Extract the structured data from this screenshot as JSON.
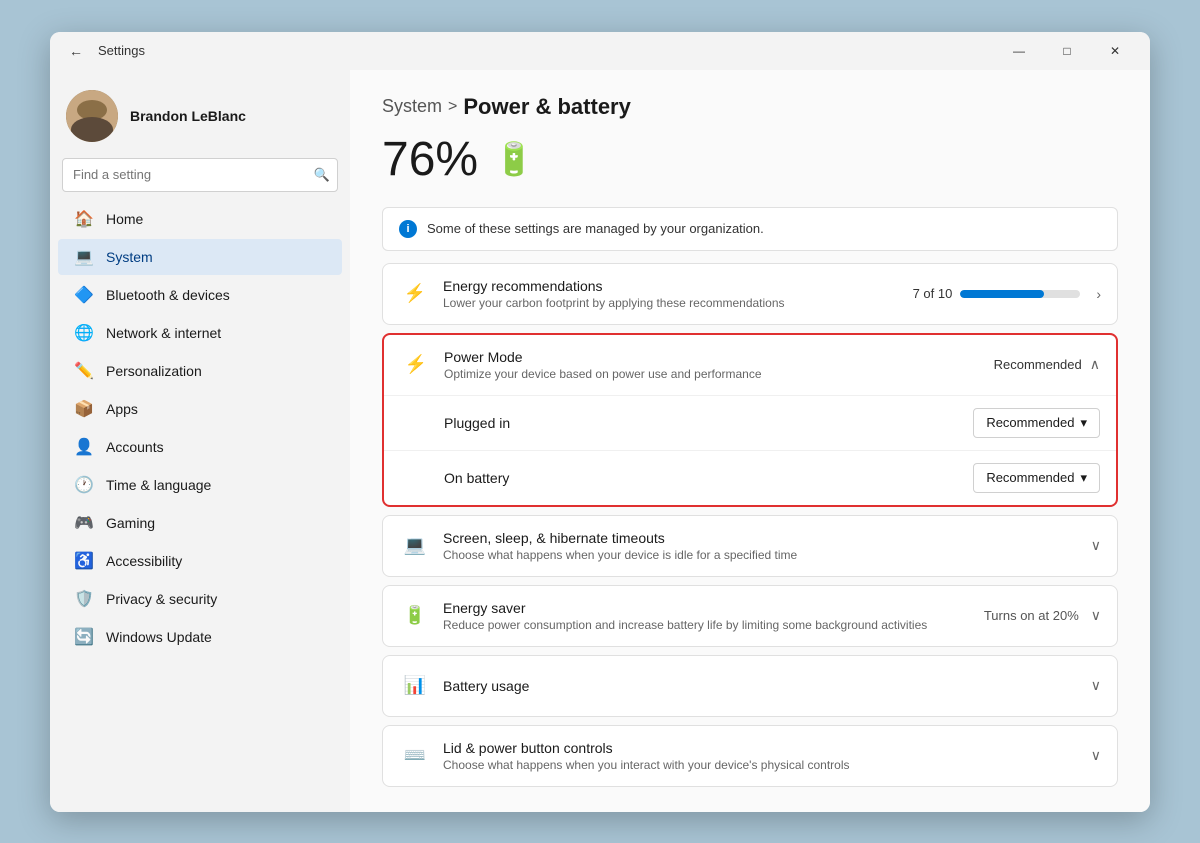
{
  "window": {
    "title": "Settings",
    "back_label": "←",
    "minimize_label": "—",
    "maximize_label": "□",
    "close_label": "✕"
  },
  "user": {
    "name": "Brandon LeBlanc"
  },
  "search": {
    "placeholder": "Find a setting"
  },
  "nav": {
    "items": [
      {
        "id": "home",
        "label": "Home",
        "icon": "🏠"
      },
      {
        "id": "system",
        "label": "System",
        "icon": "💻",
        "active": true
      },
      {
        "id": "bluetooth",
        "label": "Bluetooth & devices",
        "icon": "🔷"
      },
      {
        "id": "network",
        "label": "Network & internet",
        "icon": "🌐"
      },
      {
        "id": "personalization",
        "label": "Personalization",
        "icon": "✏️"
      },
      {
        "id": "apps",
        "label": "Apps",
        "icon": "📦"
      },
      {
        "id": "accounts",
        "label": "Accounts",
        "icon": "👤"
      },
      {
        "id": "time",
        "label": "Time & language",
        "icon": "🕐"
      },
      {
        "id": "gaming",
        "label": "Gaming",
        "icon": "🎮"
      },
      {
        "id": "accessibility",
        "label": "Accessibility",
        "icon": "♿"
      },
      {
        "id": "privacy",
        "label": "Privacy & security",
        "icon": "🛡️"
      },
      {
        "id": "update",
        "label": "Windows Update",
        "icon": "🔄"
      }
    ]
  },
  "breadcrumb": {
    "parent": "System",
    "separator": ">",
    "current": "Power & battery"
  },
  "battery": {
    "percent": "76%",
    "icon": "🔋"
  },
  "info_banner": {
    "icon": "i",
    "text": "Some of these settings are managed by your organization."
  },
  "sections": {
    "energy_recommendations": {
      "title": "Energy recommendations",
      "desc": "Lower your carbon footprint by applying these recommendations",
      "progress_label": "7 of 10",
      "progress_percent": 70,
      "icon": "⚡"
    },
    "power_mode": {
      "title": "Power Mode",
      "desc": "Optimize your device based on power use and performance",
      "value": "Recommended",
      "icon": "⚡",
      "sub_items": [
        {
          "label": "Plugged in",
          "value": "Recommended"
        },
        {
          "label": "On battery",
          "value": "Recommended"
        }
      ]
    },
    "screen_sleep": {
      "title": "Screen, sleep, & hibernate timeouts",
      "desc": "Choose what happens when your device is idle for a specified time",
      "icon": "💻"
    },
    "energy_saver": {
      "title": "Energy saver",
      "desc": "Reduce power consumption and increase battery life by limiting some background activities",
      "value": "Turns on at 20%",
      "icon": "🔋"
    },
    "battery_usage": {
      "title": "Battery usage",
      "icon": "📊"
    },
    "lid_controls": {
      "title": "Lid & power button controls",
      "desc": "Choose what happens when you interact with your device's physical controls",
      "icon": "⌨️"
    }
  }
}
